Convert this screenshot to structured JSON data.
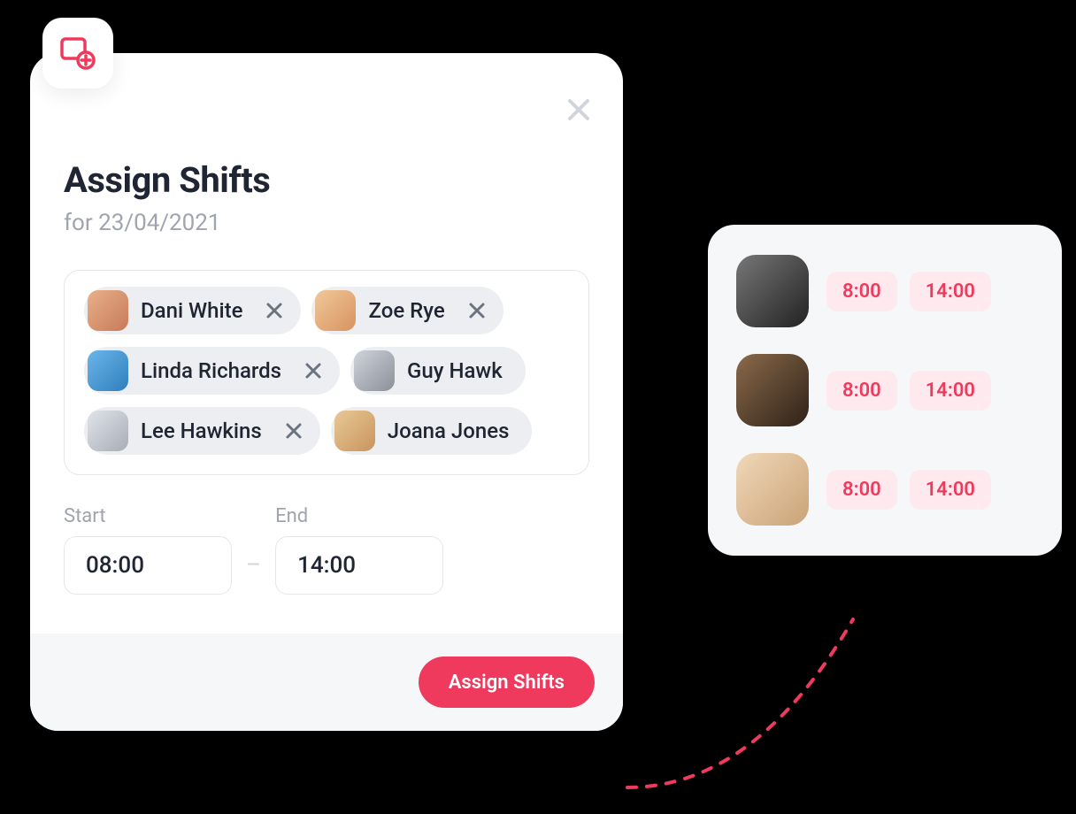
{
  "modal": {
    "title": "Assign Shifts",
    "subtitle": "for 23/04/2021",
    "people": [
      {
        "name": "Dani White",
        "removable": true
      },
      {
        "name": "Zoe Rye",
        "removable": true
      },
      {
        "name": "Linda Richards",
        "removable": true
      },
      {
        "name": "Guy Hawk",
        "removable": false
      },
      {
        "name": "Lee Hawkins",
        "removable": true
      },
      {
        "name": "Joana Jones",
        "removable": false
      }
    ],
    "start_label": "Start",
    "end_label": "End",
    "start_value": "08:00",
    "end_value": "14:00",
    "submit_label": "Assign Shifts"
  },
  "side": {
    "rows": [
      {
        "start": "8:00",
        "end": "14:00"
      },
      {
        "start": "8:00",
        "end": "14:00"
      },
      {
        "start": "8:00",
        "end": "14:00"
      }
    ]
  },
  "colors": {
    "accent": "#ef3a5d",
    "pill_bg": "#fde9ee"
  }
}
